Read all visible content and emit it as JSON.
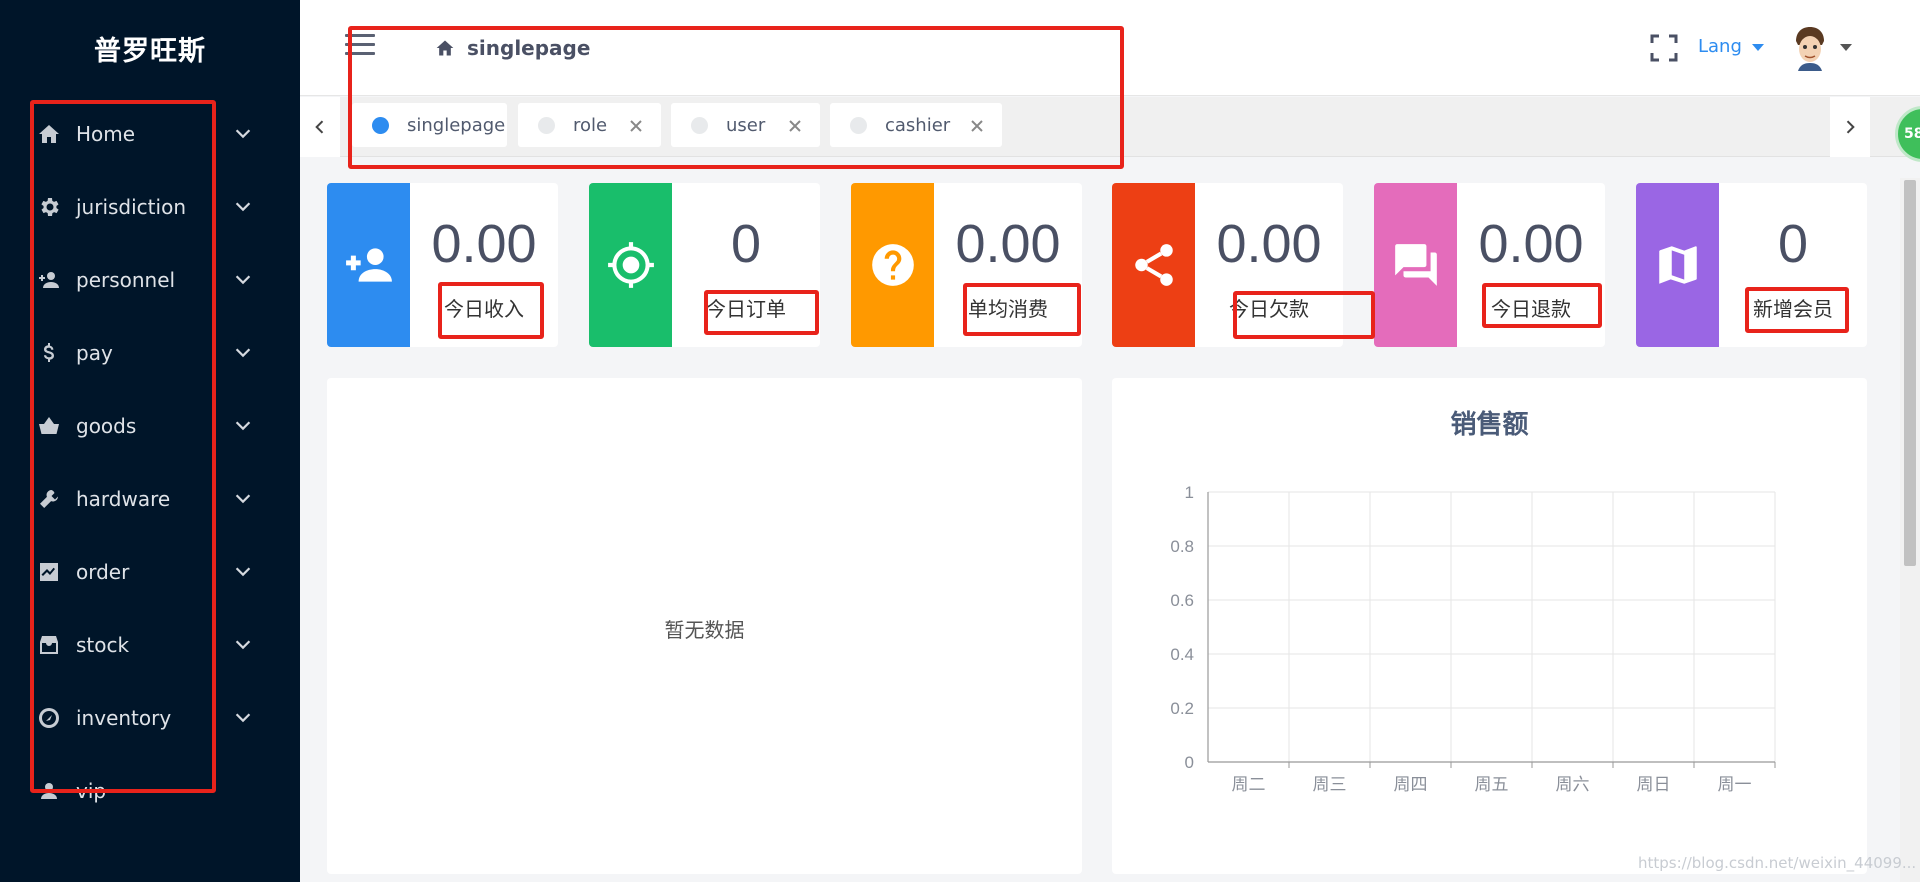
{
  "sidebar": {
    "brand": "普罗旺斯",
    "items": [
      {
        "label": "Home",
        "icon": "home-icon"
      },
      {
        "label": "jurisdiction",
        "icon": "gear-icon"
      },
      {
        "label": "personnel",
        "icon": "user-add-icon"
      },
      {
        "label": "pay",
        "icon": "dollar-icon"
      },
      {
        "label": "goods",
        "icon": "basket-icon"
      },
      {
        "label": "hardware",
        "icon": "tools-icon"
      },
      {
        "label": "order",
        "icon": "chart-icon"
      },
      {
        "label": "stock",
        "icon": "box-icon"
      },
      {
        "label": "inventory",
        "icon": "compass-icon"
      },
      {
        "label": "vip",
        "icon": "vip-user-icon"
      }
    ]
  },
  "header": {
    "breadcrumb": "singlepage",
    "lang_label": "Lang"
  },
  "tabs": [
    {
      "label": "singlepage",
      "active": true,
      "closable": false
    },
    {
      "label": "role",
      "active": false,
      "closable": true
    },
    {
      "label": "user",
      "active": false,
      "closable": true
    },
    {
      "label": "cashier",
      "active": false,
      "closable": true
    }
  ],
  "badge": {
    "count": "58"
  },
  "stats": [
    {
      "value": "0.00",
      "label": "今日收入",
      "color": "#2d8cf0",
      "icon": "user-add-icon"
    },
    {
      "value": "0",
      "label": "今日订单",
      "color": "#19be6b",
      "icon": "locate-icon"
    },
    {
      "value": "0.00",
      "label": "单均消费",
      "color": "#ff9900",
      "icon": "help-icon"
    },
    {
      "value": "0.00",
      "label": "今日欠款",
      "color": "#ed3f14",
      "icon": "share-icon"
    },
    {
      "value": "0.00",
      "label": "今日退款",
      "color": "#e46cbb",
      "icon": "chat-icon"
    },
    {
      "value": "0",
      "label": "新增会员",
      "color": "#9a66e4",
      "icon": "map-icon"
    }
  ],
  "empty_panel": {
    "text": "暂无数据"
  },
  "chart_data": {
    "type": "line",
    "title": "销售额",
    "categories": [
      "周二",
      "周三",
      "周四",
      "周五",
      "周六",
      "周日",
      "周一"
    ],
    "series": [],
    "ylim": [
      0,
      1
    ],
    "yticks": [
      "0",
      "0.2",
      "0.4",
      "0.6",
      "0.8",
      "1"
    ],
    "grid": true
  },
  "watermark": "https://blog.csdn.net/weixin_44099..."
}
